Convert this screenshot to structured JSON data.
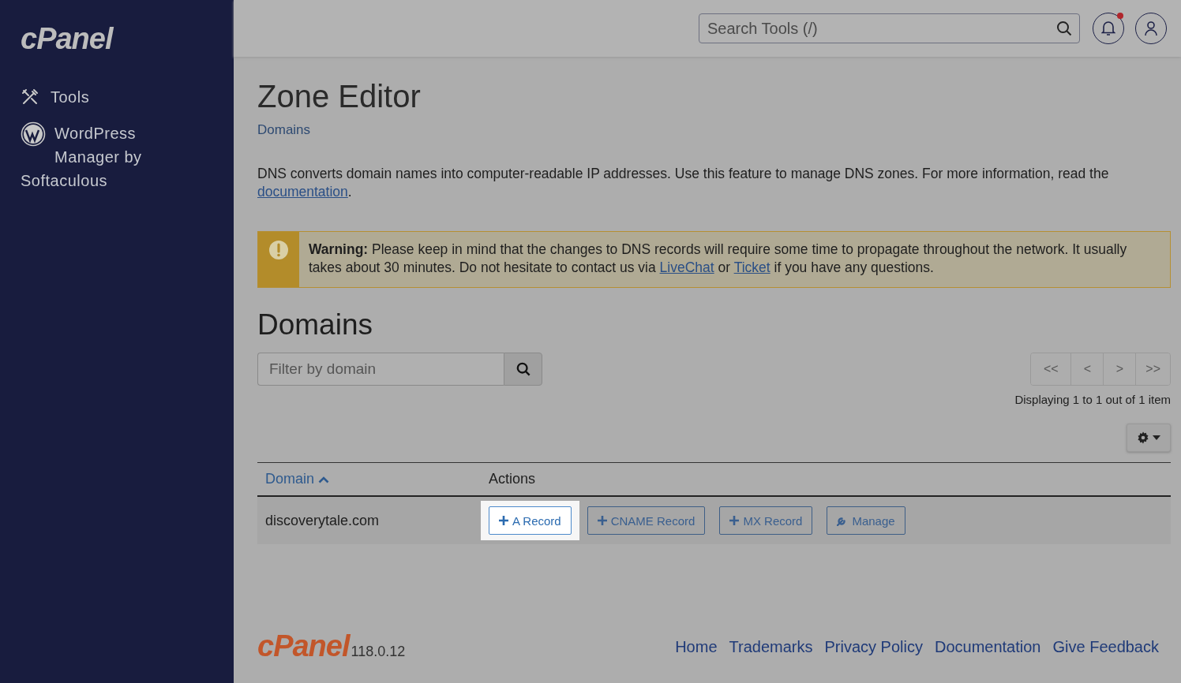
{
  "sidebar": {
    "logo": "cPanel",
    "items": [
      {
        "label": "Tools",
        "kind": "tools"
      },
      {
        "label": "WordPress Manager by Softaculous",
        "kind": "wordpress"
      }
    ]
  },
  "topbar": {
    "search": {
      "placeholder": "Search Tools (/)"
    },
    "notifications": {
      "unread": true
    }
  },
  "page": {
    "title": "Zone Editor",
    "breadcrumb": "Domains",
    "description": [
      {
        "kind": "text",
        "text": "DNS converts domain names into computer-readable IP addresses. Use this feature to manage DNS zones. For more information, read the "
      },
      {
        "kind": "link",
        "text": "documentation"
      },
      {
        "kind": "text",
        "text": "."
      }
    ]
  },
  "warning": {
    "label": "Warning:",
    "parts": [
      {
        "kind": "text",
        "text": " Please keep in mind that the changes to DNS records will require some time to propagate throughout the network. It usually takes about 30 minutes. Do not hesitate to contact us via "
      },
      {
        "kind": "link",
        "text": "LiveChat"
      },
      {
        "kind": "text",
        "text": " or "
      },
      {
        "kind": "link",
        "text": "Ticket"
      },
      {
        "kind": "text",
        "text": " if you have any questions."
      }
    ]
  },
  "domains": {
    "heading": "Domains",
    "filter": {
      "placeholder": "Filter by domain"
    },
    "pagination": [
      "<<",
      "<",
      ">",
      ">>"
    ],
    "summary": "Displaying 1 to 1 out of 1 item",
    "table": {
      "columns": [
        {
          "label": "Domain",
          "sorted": true
        },
        {
          "label": "Actions",
          "sorted": false
        }
      ],
      "rows": [
        {
          "domain": "discoverytale.com",
          "actions": [
            {
              "label": "A Record",
              "kind": "add",
              "highlighted": true
            },
            {
              "label": "CNAME Record",
              "kind": "add",
              "highlighted": false
            },
            {
              "label": "MX Record",
              "kind": "add",
              "highlighted": false
            },
            {
              "label": "Manage",
              "kind": "manage",
              "highlighted": false
            }
          ]
        }
      ]
    }
  },
  "footer": {
    "logo": "cPanel",
    "version": "118.0.12",
    "links": [
      "Home",
      "Trademarks",
      "Privacy Policy",
      "Documentation",
      "Give Feedback"
    ]
  }
}
